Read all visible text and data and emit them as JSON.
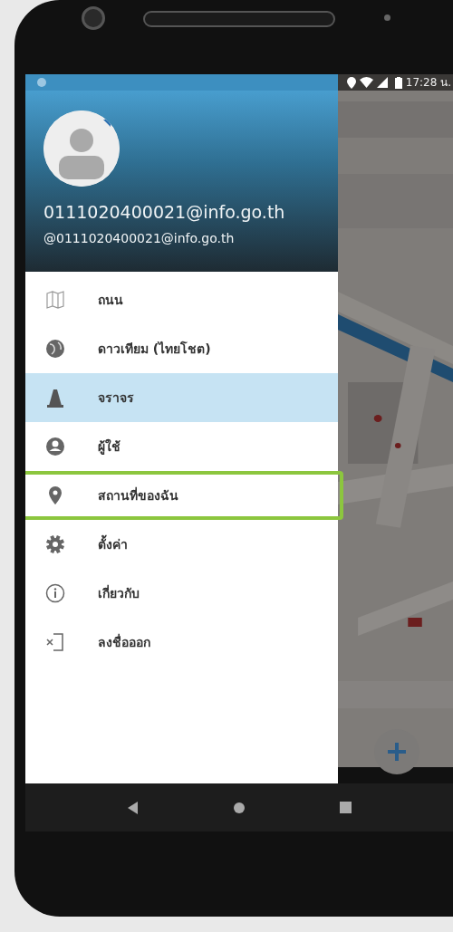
{
  "status_bar": {
    "time": "17:28 น."
  },
  "account": {
    "name": "0111020400021@info.go.th",
    "handle": "@0111020400021@info.go.th"
  },
  "menu": [
    {
      "kind": "map",
      "label": "ถนน",
      "selected": false,
      "highlighted": false
    },
    {
      "kind": "globe",
      "label": "ดาวเทียม (ไทยโชต)",
      "selected": false,
      "highlighted": false
    },
    {
      "kind": "cone",
      "label": "จราจร",
      "selected": true,
      "highlighted": false
    },
    {
      "kind": "user",
      "label": "ผู้ใช้",
      "selected": false,
      "highlighted": false
    },
    {
      "kind": "pin",
      "label": "สถานที่ของฉัน",
      "selected": false,
      "highlighted": true
    },
    {
      "kind": "gear",
      "label": "ตั้งค่า",
      "selected": false,
      "highlighted": false
    },
    {
      "kind": "info",
      "label": "เกี่ยวกับ",
      "selected": false,
      "highlighted": false
    },
    {
      "kind": "logout",
      "label": "ลงชื่อออก",
      "selected": false,
      "highlighted": false
    }
  ]
}
